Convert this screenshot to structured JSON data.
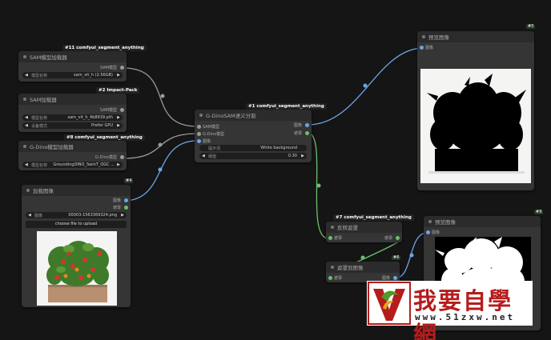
{
  "nodes": {
    "sam_loader": {
      "tag": "#11 comfyui_segment_anything",
      "title": "SAM模型加载器",
      "output": "SAM模型",
      "widget_label": "模型名称",
      "widget_value": "sam_vit_h (2.56GB)"
    },
    "impact_loader": {
      "tag": "#2 Impact-Pack",
      "title": "SAM加载器",
      "output": "SAM模型",
      "widget1_label": "模型名称",
      "widget1_value": "sam_vit_h_4b8939.pth",
      "widget2_label": "设备模式",
      "widget2_value": "Prefer GPU"
    },
    "dino_loader": {
      "tag": "#8 comfyui_segment_anything",
      "title": "G-Dino模型加载器",
      "output": "G-Dino模型",
      "widget_label": "模型名称",
      "widget_value": "GroundingDINO_SwinT_OGC ..."
    },
    "load_image": {
      "badge": "#4",
      "title": "加载图像",
      "output1": "图像",
      "output2": "遮罩",
      "widget_label": "图像",
      "widget_value": "00003-1563369324.png",
      "upload": "choose file to upload"
    },
    "gdino_sam": {
      "tag": "#1 comfyui_segment_anything",
      "title": "G-DinoSAM语义分割",
      "input1": "SAM模型",
      "input2": "G-Dino模型",
      "input3": "图像",
      "output1": "图像",
      "output2": "遮罩",
      "widget1_label": "提示词",
      "widget1_value": "White background",
      "widget2_label": "阈值",
      "widget2_value": "0.30"
    },
    "preview1": {
      "badge": "#5",
      "title": "预览图像",
      "input": "图像"
    },
    "invert_mask": {
      "tag": "#7 comfyui_segment_anything",
      "title": "反转遮罩",
      "input": "遮罩",
      "output": "遮罩"
    },
    "mask_to_image": {
      "badge": "#6",
      "title": "遮罩到图像",
      "input": "遮罩",
      "output": "图像"
    },
    "preview2": {
      "badge": "#9",
      "title": "预览图像",
      "input": "图像"
    }
  },
  "watermark": {
    "text": "我要自學網",
    "url": "www.51zxw.net",
    "logo_letter": "V"
  },
  "colors": {
    "canvas": "#151515",
    "node": "#353535",
    "header": "#2b2b2b",
    "wire_blue": "#6aa7e8",
    "wire_green": "#6cbf6c",
    "wire_gray": "#9a9a9a",
    "brand_red": "#b51c1c"
  }
}
